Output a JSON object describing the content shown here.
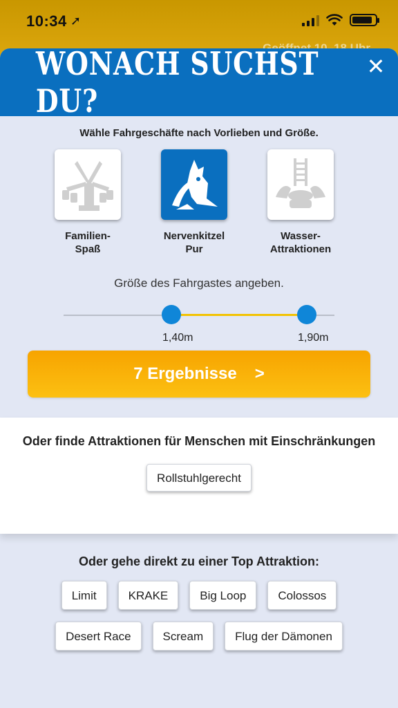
{
  "status_bar": {
    "time": "10:34",
    "location_glyph": "➚"
  },
  "background": {
    "opening_hours": "Geöffnet 10–18 Uhr"
  },
  "sheet": {
    "title": "WONACH SUCHST DU?",
    "close_glyph": "✕",
    "intro": "Wähle Fahrgeschäfte nach Vorlieben und Größe.",
    "categories": [
      {
        "line1": "Familien-",
        "line2": "Spaß",
        "icon": "carousel-icon",
        "selected": false
      },
      {
        "line1": "Nervenkitzel",
        "line2": "Pur",
        "icon": "monster-icon",
        "selected": true
      },
      {
        "line1": "Wasser-",
        "line2": "Attraktionen",
        "icon": "water-ride-icon",
        "selected": false
      }
    ],
    "size_label": "Größe des Fahrgastes angeben.",
    "slider": {
      "min_value": "1,40m",
      "max_value": "1,90m"
    },
    "result_button": {
      "label": "7 Ergebnisse",
      "arrow": ">"
    },
    "restrictions": {
      "title": "Oder finde Attraktionen für Menschen mit Einschränkungen",
      "chip": "Rollstuhlgerecht"
    },
    "top_attractions": {
      "title": "Oder gehe direkt zu einer Top Attraktion:",
      "row1": [
        "Limit",
        "KRAKE",
        "Big Loop",
        "Colossos"
      ],
      "row2": [
        "Desert Race",
        "Scream",
        "Flug der Dämonen"
      ]
    }
  },
  "colors": {
    "header_blue": "#0a6fbf",
    "sheet_bg": "#e2e7f4",
    "accent_orange": "#f7a400",
    "slider_range": "#f3c300",
    "slider_thumb": "#0f86d8"
  }
}
